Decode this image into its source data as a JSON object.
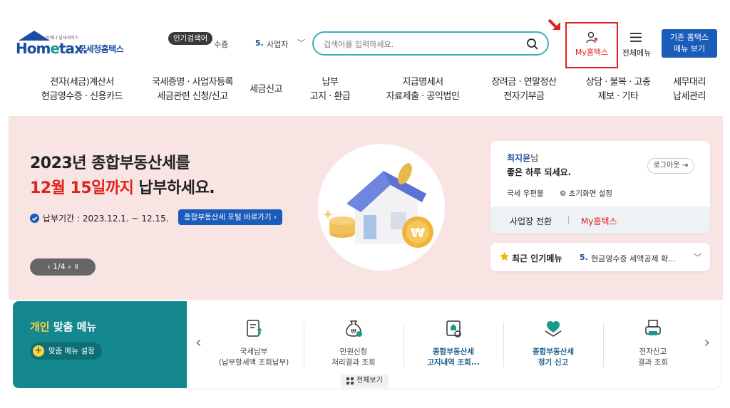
{
  "header": {
    "logo_text": "Hometax.",
    "logo_kr": "국세청홈택스",
    "logo_sub": "언제나 납세서비스",
    "popular_badge": "인기검색어",
    "popular_prev": "수증",
    "popular_num": "5.",
    "popular_item": "사업자",
    "search_placeholder": "검색어를 입력하세요.",
    "myhome_label": "My홈택스",
    "allmenu_label": "전체메뉴",
    "old_home_line1": "기존 홈택스",
    "old_home_line2": "메뉴 보기"
  },
  "nav": [
    {
      "l1": "전자(세금)계산서",
      "l2": "현금영수증 · 신용카드"
    },
    {
      "l1": "국세증명 · 사업자등록",
      "l2": "세금관련 신청/신고"
    },
    {
      "l1": "세금신고",
      "l2": ""
    },
    {
      "l1": "납부",
      "l2": "고지 · 환급"
    },
    {
      "l1": "지급명세서",
      "l2": "자료제출 · 공익법인"
    },
    {
      "l1": "장려금 · 연말정산",
      "l2": "전자기부금"
    },
    {
      "l1": "상담 · 불복 · 고충",
      "l2": "제보 · 기타"
    },
    {
      "l1": "세무대리",
      "l2": "납세관리"
    }
  ],
  "banner": {
    "line1": "2023년 종합부동산세를",
    "line2_red": "12월 15일까지",
    "line2_rest": " 납부하세요.",
    "period": "납부기간 : 2023.12.1. ~ 12.15.",
    "portal_btn": "종합부동산세 포털 바로가기 ›",
    "pager": "‹  1/4  ›   ॥"
  },
  "login_card": {
    "user_name": "최지윤",
    "user_suffix": "님",
    "greeting": "좋은 하루 되세요.",
    "logout": "로그아웃",
    "mailbox": "국세 우편물",
    "init_setting": "초기화면 설정",
    "switch_biz": "사업장 전환",
    "my_hometax": "My홈택스"
  },
  "popular_menu": {
    "label": "최근 인기메뉴",
    "num": "5.",
    "text": "현금영수증 세액공제 확..."
  },
  "custom_menu": {
    "title_hl": "개인",
    "title_rest": " 맞춤 메뉴",
    "setting": "맞춤 메뉴 설정"
  },
  "quick_menu": [
    {
      "l1": "국세납부",
      "l2": "(납부할세액 조회납부)",
      "bold": false,
      "icon": "tax-payment-icon"
    },
    {
      "l1": "민원신청",
      "l2": "처리결과 조회",
      "bold": false,
      "icon": "money-bag-icon"
    },
    {
      "l1": "종합부동산세",
      "l2": "고지내역 조회...",
      "bold": true,
      "icon": "property-notice-icon"
    },
    {
      "l1": "종합부동산세",
      "l2": "정기 신고",
      "bold": true,
      "icon": "heart-hands-icon"
    },
    {
      "l1": "전자신고",
      "l2": "결과 조회",
      "bold": false,
      "icon": "printer-icon"
    }
  ],
  "view_all": "전체보기",
  "colors": {
    "brand_blue": "#1a5cba",
    "teal": "#14888e",
    "red": "#e0201c",
    "banner_bg": "#f8e5e3"
  }
}
